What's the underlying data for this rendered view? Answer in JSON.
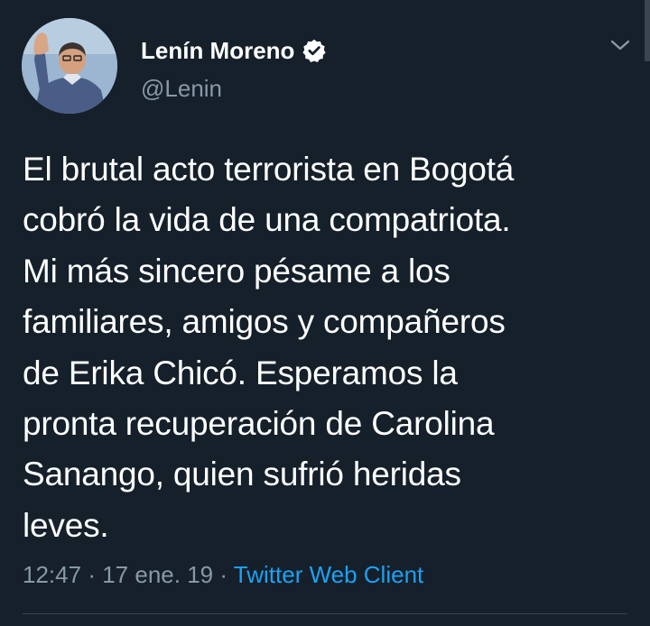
{
  "tweet": {
    "author": {
      "display_name": "Lenín Moreno",
      "handle": "@Lenin",
      "verified": true
    },
    "text_lines": [
      "El brutal acto terrorista en Bogotá",
      "cobró la vida de una compatriota.",
      "Mi más sincero pésame a los",
      "familiares, amigos y compañeros",
      "de Erika Chicó. Esperamos la",
      "pronta recuperación de Carolina",
      "Sanango, quien sufrió heridas",
      "leves."
    ],
    "time": "12:47",
    "separator": "·",
    "date": "17 ene. 19",
    "source": "Twitter Web Client"
  },
  "icons": {
    "verified": "verified-badge-icon",
    "menu": "chevron-down-icon"
  },
  "colors": {
    "background": "#15202b",
    "text": "#ffffff",
    "secondary_text": "#8899a6",
    "link": "#1da1f2",
    "divider": "#38444d"
  }
}
